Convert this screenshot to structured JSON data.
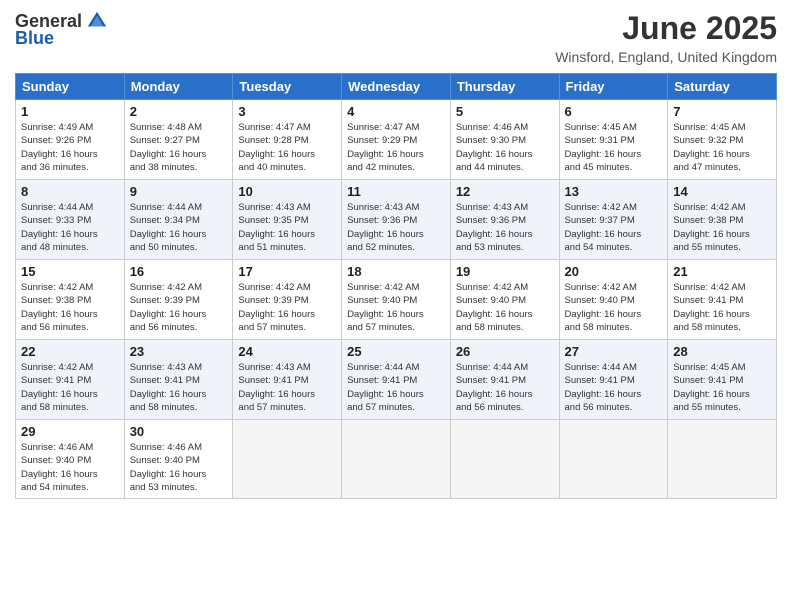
{
  "logo": {
    "general": "General",
    "blue": "Blue"
  },
  "title": "June 2025",
  "location": "Winsford, England, United Kingdom",
  "days_of_week": [
    "Sunday",
    "Monday",
    "Tuesday",
    "Wednesday",
    "Thursday",
    "Friday",
    "Saturday"
  ],
  "weeks": [
    [
      {
        "day": "1",
        "info": "Sunrise: 4:49 AM\nSunset: 9:26 PM\nDaylight: 16 hours\nand 36 minutes."
      },
      {
        "day": "2",
        "info": "Sunrise: 4:48 AM\nSunset: 9:27 PM\nDaylight: 16 hours\nand 38 minutes."
      },
      {
        "day": "3",
        "info": "Sunrise: 4:47 AM\nSunset: 9:28 PM\nDaylight: 16 hours\nand 40 minutes."
      },
      {
        "day": "4",
        "info": "Sunrise: 4:47 AM\nSunset: 9:29 PM\nDaylight: 16 hours\nand 42 minutes."
      },
      {
        "day": "5",
        "info": "Sunrise: 4:46 AM\nSunset: 9:30 PM\nDaylight: 16 hours\nand 44 minutes."
      },
      {
        "day": "6",
        "info": "Sunrise: 4:45 AM\nSunset: 9:31 PM\nDaylight: 16 hours\nand 45 minutes."
      },
      {
        "day": "7",
        "info": "Sunrise: 4:45 AM\nSunset: 9:32 PM\nDaylight: 16 hours\nand 47 minutes."
      }
    ],
    [
      {
        "day": "8",
        "info": "Sunrise: 4:44 AM\nSunset: 9:33 PM\nDaylight: 16 hours\nand 48 minutes."
      },
      {
        "day": "9",
        "info": "Sunrise: 4:44 AM\nSunset: 9:34 PM\nDaylight: 16 hours\nand 50 minutes."
      },
      {
        "day": "10",
        "info": "Sunrise: 4:43 AM\nSunset: 9:35 PM\nDaylight: 16 hours\nand 51 minutes."
      },
      {
        "day": "11",
        "info": "Sunrise: 4:43 AM\nSunset: 9:36 PM\nDaylight: 16 hours\nand 52 minutes."
      },
      {
        "day": "12",
        "info": "Sunrise: 4:43 AM\nSunset: 9:36 PM\nDaylight: 16 hours\nand 53 minutes."
      },
      {
        "day": "13",
        "info": "Sunrise: 4:42 AM\nSunset: 9:37 PM\nDaylight: 16 hours\nand 54 minutes."
      },
      {
        "day": "14",
        "info": "Sunrise: 4:42 AM\nSunset: 9:38 PM\nDaylight: 16 hours\nand 55 minutes."
      }
    ],
    [
      {
        "day": "15",
        "info": "Sunrise: 4:42 AM\nSunset: 9:38 PM\nDaylight: 16 hours\nand 56 minutes."
      },
      {
        "day": "16",
        "info": "Sunrise: 4:42 AM\nSunset: 9:39 PM\nDaylight: 16 hours\nand 56 minutes."
      },
      {
        "day": "17",
        "info": "Sunrise: 4:42 AM\nSunset: 9:39 PM\nDaylight: 16 hours\nand 57 minutes."
      },
      {
        "day": "18",
        "info": "Sunrise: 4:42 AM\nSunset: 9:40 PM\nDaylight: 16 hours\nand 57 minutes."
      },
      {
        "day": "19",
        "info": "Sunrise: 4:42 AM\nSunset: 9:40 PM\nDaylight: 16 hours\nand 58 minutes."
      },
      {
        "day": "20",
        "info": "Sunrise: 4:42 AM\nSunset: 9:40 PM\nDaylight: 16 hours\nand 58 minutes."
      },
      {
        "day": "21",
        "info": "Sunrise: 4:42 AM\nSunset: 9:41 PM\nDaylight: 16 hours\nand 58 minutes."
      }
    ],
    [
      {
        "day": "22",
        "info": "Sunrise: 4:42 AM\nSunset: 9:41 PM\nDaylight: 16 hours\nand 58 minutes."
      },
      {
        "day": "23",
        "info": "Sunrise: 4:43 AM\nSunset: 9:41 PM\nDaylight: 16 hours\nand 58 minutes."
      },
      {
        "day": "24",
        "info": "Sunrise: 4:43 AM\nSunset: 9:41 PM\nDaylight: 16 hours\nand 57 minutes."
      },
      {
        "day": "25",
        "info": "Sunrise: 4:44 AM\nSunset: 9:41 PM\nDaylight: 16 hours\nand 57 minutes."
      },
      {
        "day": "26",
        "info": "Sunrise: 4:44 AM\nSunset: 9:41 PM\nDaylight: 16 hours\nand 56 minutes."
      },
      {
        "day": "27",
        "info": "Sunrise: 4:44 AM\nSunset: 9:41 PM\nDaylight: 16 hours\nand 56 minutes."
      },
      {
        "day": "28",
        "info": "Sunrise: 4:45 AM\nSunset: 9:41 PM\nDaylight: 16 hours\nand 55 minutes."
      }
    ],
    [
      {
        "day": "29",
        "info": "Sunrise: 4:46 AM\nSunset: 9:40 PM\nDaylight: 16 hours\nand 54 minutes."
      },
      {
        "day": "30",
        "info": "Sunrise: 4:46 AM\nSunset: 9:40 PM\nDaylight: 16 hours\nand 53 minutes."
      },
      {
        "day": "",
        "info": ""
      },
      {
        "day": "",
        "info": ""
      },
      {
        "day": "",
        "info": ""
      },
      {
        "day": "",
        "info": ""
      },
      {
        "day": "",
        "info": ""
      }
    ]
  ]
}
